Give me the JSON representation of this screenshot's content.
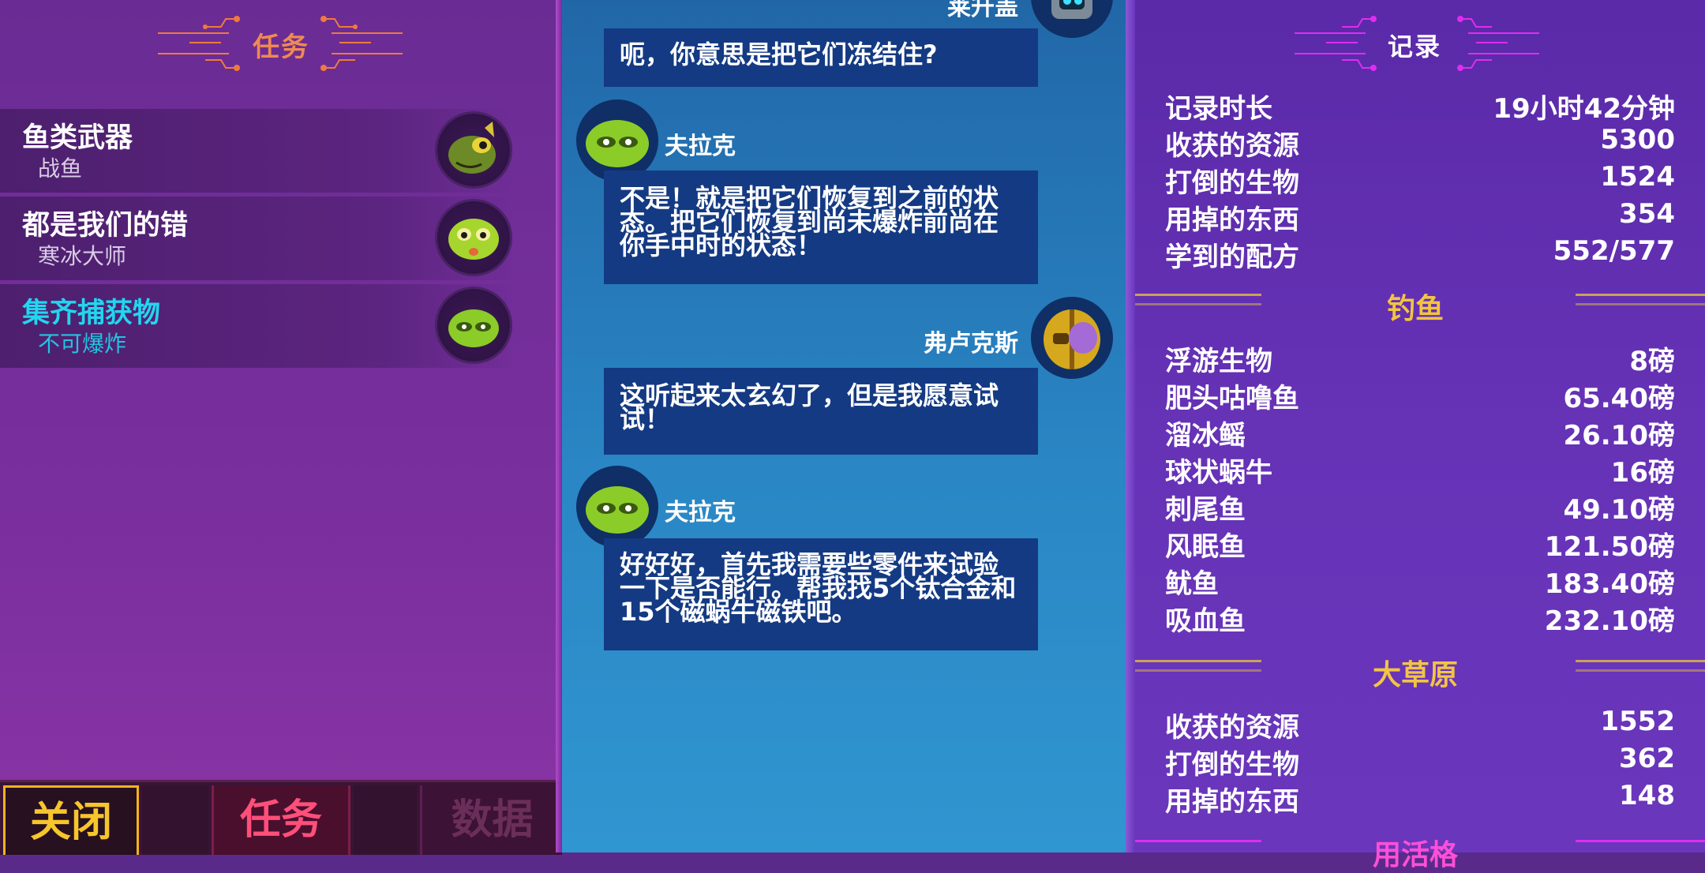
{
  "left": {
    "header": "任务",
    "quests": [
      {
        "title": "鱼类武器",
        "subtitle": "战鱼"
      },
      {
        "title": "都是我们的错",
        "subtitle": "寒冰大师"
      },
      {
        "title": "集齐捕获物",
        "subtitle": "不可爆炸"
      }
    ],
    "tabs": {
      "close": "关闭",
      "quests": "任务",
      "data": "数据"
    }
  },
  "dialogue": [
    {
      "speaker": "",
      "text": "呃，你意思是把它们冻结住?"
    },
    {
      "speaker": "夫拉克",
      "text": "不是！就是把它们恢复到之前的状态。把它们恢复到尚未爆炸前尚在你手中时的状态！"
    },
    {
      "speaker": "弗卢克斯",
      "text": "这听起来太玄幻了，但是我愿意试试！"
    },
    {
      "speaker": "夫拉克",
      "text": "好好好，首先我需要些零件来试验一下是否能行。帮我找5个钛合金和15个磁蜗牛磁铁吧。"
    }
  ],
  "top_speaker_partial": "莱升盖",
  "records": {
    "header": "记录",
    "general": [
      {
        "label": "记录时长",
        "value": "19小时42分钟"
      },
      {
        "label": "收获的资源",
        "value": "5300"
      },
      {
        "label": "打倒的生物",
        "value": "1524"
      },
      {
        "label": "用掉的东西",
        "value": "354"
      },
      {
        "label": "学到的配方",
        "value": "552/577"
      }
    ],
    "fishing_title": "钓鱼",
    "fishing": [
      {
        "label": "浮游生物",
        "value": "8磅"
      },
      {
        "label": "肥头咕噜鱼",
        "value": "65.40磅"
      },
      {
        "label": "溜冰鳐",
        "value": "26.10磅"
      },
      {
        "label": "球状蜗牛",
        "value": "16磅"
      },
      {
        "label": "刺尾鱼",
        "value": "49.10磅"
      },
      {
        "label": "风眠鱼",
        "value": "121.50磅"
      },
      {
        "label": "鱿鱼",
        "value": "183.40磅"
      },
      {
        "label": "吸血鱼",
        "value": "232.10磅"
      }
    ],
    "savanna_title": "大草原",
    "savanna": [
      {
        "label": "收获的资源",
        "value": "1552"
      },
      {
        "label": "打倒的生物",
        "value": "362"
      },
      {
        "label": "用掉的东西",
        "value": "148"
      }
    ],
    "next_title_partial": "用活格"
  },
  "colors": {
    "active_quest": "#22d6ef",
    "section_title": "#f2c542",
    "close_tab": "#f7c52c",
    "quest_tab": "#ff4f7a"
  }
}
